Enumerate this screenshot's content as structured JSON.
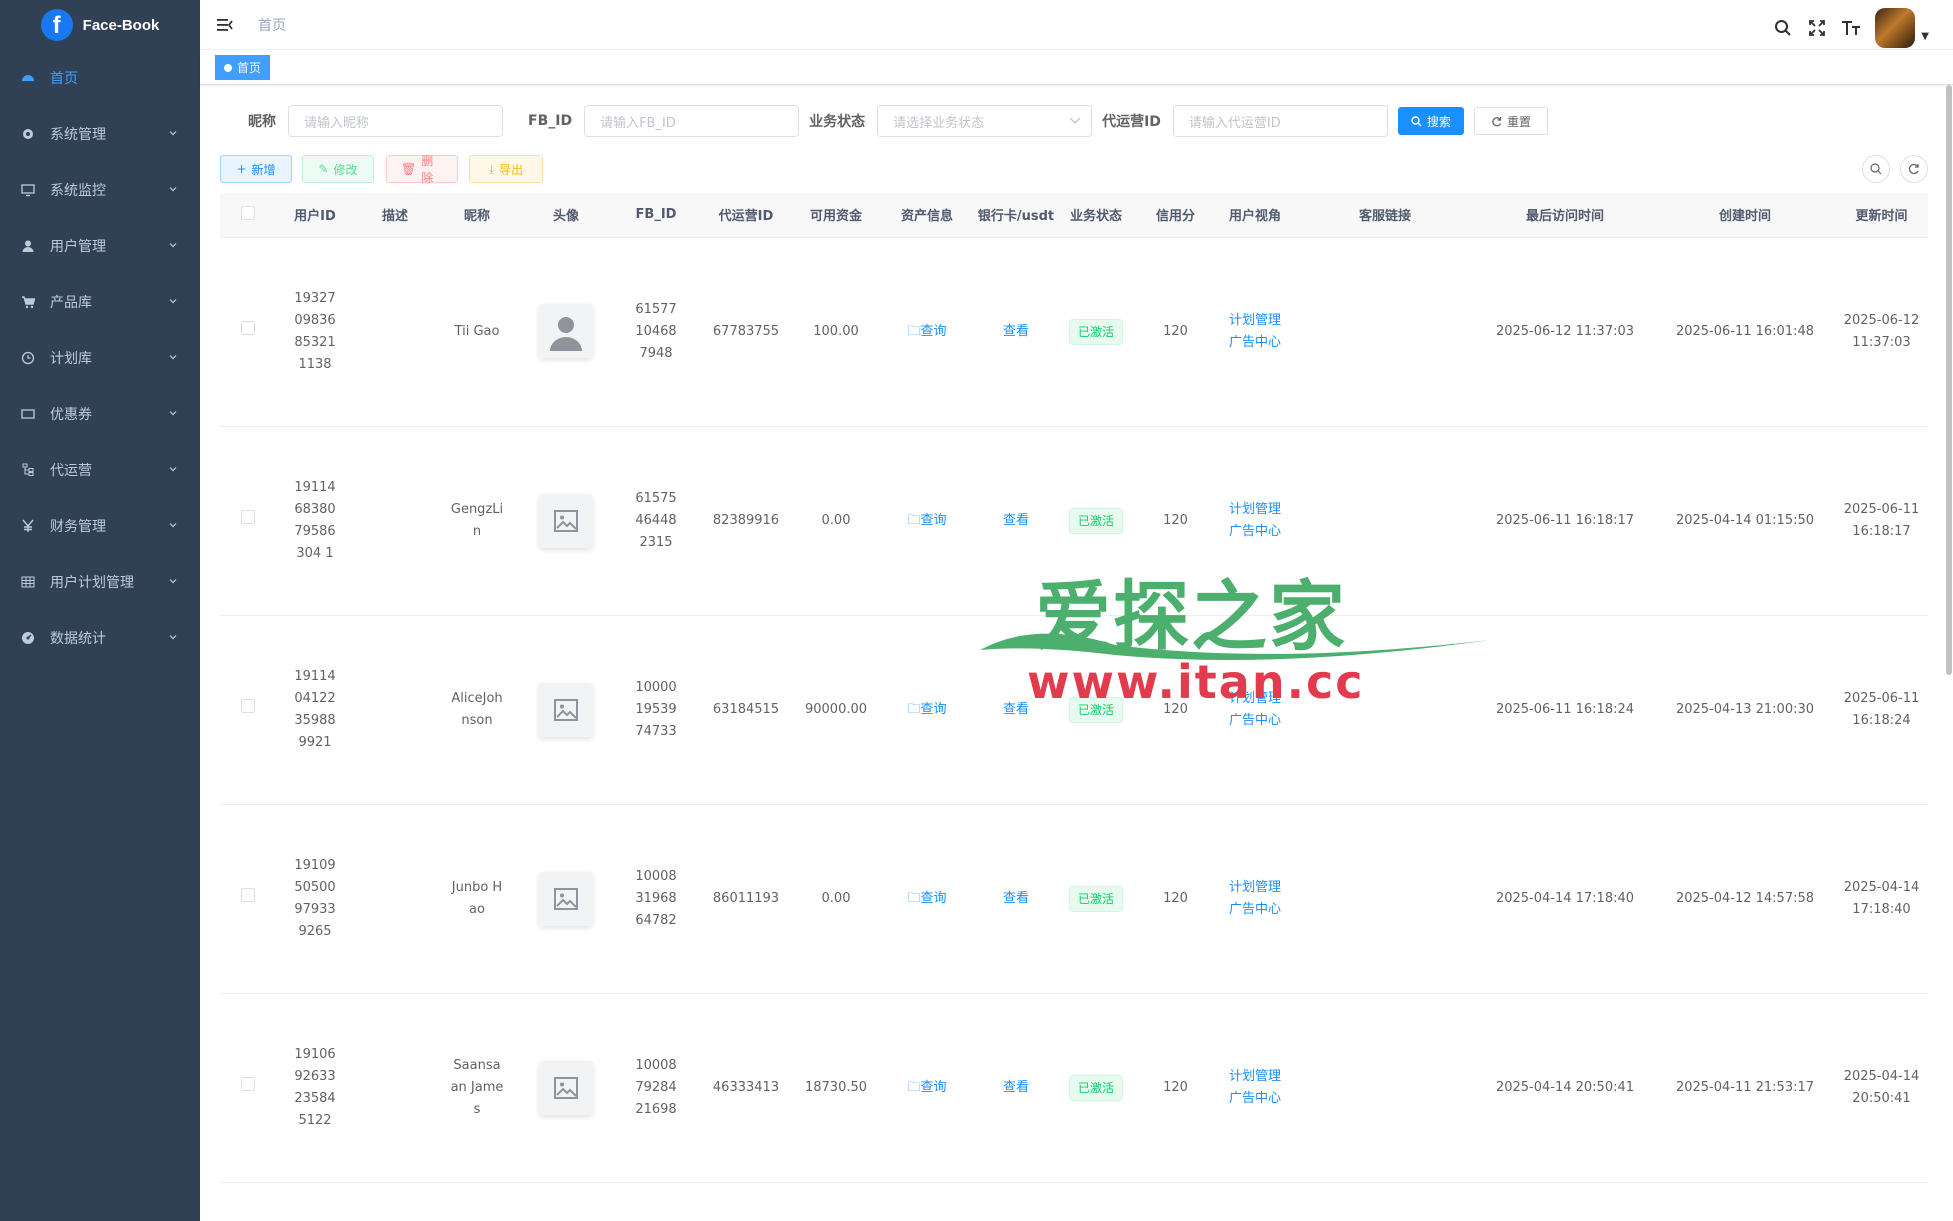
{
  "app": {
    "brand": "Face-Book",
    "logo_letter": "f"
  },
  "sidebar": {
    "items": [
      {
        "label": "首页",
        "icon": "dashboard-icon",
        "active": true,
        "expandable": false
      },
      {
        "label": "系统管理",
        "icon": "gear-icon",
        "expandable": true
      },
      {
        "label": "系统监控",
        "icon": "monitor-icon",
        "expandable": true
      },
      {
        "label": "用户管理",
        "icon": "user-icon",
        "expandable": true
      },
      {
        "label": "产品库",
        "icon": "cart-icon",
        "expandable": true
      },
      {
        "label": "计划库",
        "icon": "clock-icon",
        "expandable": true
      },
      {
        "label": "优惠券",
        "icon": "coupon-icon",
        "expandable": true
      },
      {
        "label": "代运营",
        "icon": "tree-icon",
        "expandable": true
      },
      {
        "label": "财务管理",
        "icon": "yen-icon",
        "expandable": true
      },
      {
        "label": "用户计划管理",
        "icon": "table-icon",
        "expandable": true
      },
      {
        "label": "数据统计",
        "icon": "chart-icon",
        "expandable": true
      }
    ]
  },
  "header": {
    "breadcrumb": "首页"
  },
  "tags": {
    "active": "首页"
  },
  "search": {
    "nickname_label": "昵称",
    "nickname_placeholder": "请输入昵称",
    "fbid_label": "FB_ID",
    "fbid_placeholder": "请输入FB_ID",
    "status_label": "业务状态",
    "status_placeholder": "请选择业务状态",
    "agent_label": "代运营ID",
    "agent_placeholder": "请输入代运营ID",
    "search_btn": "搜索",
    "reset_btn": "重置"
  },
  "toolbar": {
    "add": "新增",
    "edit": "修改",
    "delete": "删除",
    "export": "导出"
  },
  "table": {
    "headers": [
      "用户ID",
      "描述",
      "昵称",
      "头像",
      "FB_ID",
      "代运营ID",
      "可用资金",
      "资产信息",
      "银行卡/usdt",
      "业务状态",
      "信用分",
      "用户视角",
      "客服链接",
      "最后访问时间",
      "创建时间",
      "更新时间"
    ],
    "asset_link": "查询",
    "bank_link": "查看",
    "view_link_1": "计划管理",
    "view_link_2": "广告中心",
    "rows": [
      {
        "user_id": "1932709836853211138",
        "desc": "",
        "nickname": "Tii Gao",
        "avatar": "person",
        "fb_id": "61577104687948",
        "agent_id": "67783755",
        "balance": "100.00",
        "status": "已激活",
        "credit": "120",
        "last_visit": "2025-06-12 11:37:03",
        "created": "2025-06-11 16:01:48",
        "updated": "2025-06-12 11:37:03"
      },
      {
        "user_id": "191146838079586304 1",
        "desc": "",
        "nickname": "GengzLin",
        "avatar": "image",
        "fb_id": "61575464482315",
        "agent_id": "82389916",
        "balance": "0.00",
        "status": "已激活",
        "credit": "120",
        "last_visit": "2025-06-11 16:18:17",
        "created": "2025-04-14 01:15:50",
        "updated": "2025-06-11 16:18:17"
      },
      {
        "user_id": "1911404122359889921",
        "desc": "",
        "nickname": "AliceJohnson",
        "avatar": "image",
        "fb_id": "100001953974733",
        "agent_id": "63184515",
        "balance": "90000.00",
        "status": "已激活",
        "credit": "120",
        "last_visit": "2025-06-11 16:18:24",
        "created": "2025-04-13 21:00:30",
        "updated": "2025-06-11 16:18:24"
      },
      {
        "user_id": "1910950500979339265",
        "desc": "",
        "nickname": "Junbo Hao",
        "avatar": "image",
        "fb_id": "100083196864782",
        "agent_id": "86011193",
        "balance": "0.00",
        "status": "已激活",
        "credit": "120",
        "last_visit": "2025-04-14 17:18:40",
        "created": "2025-04-12 14:57:58",
        "updated": "2025-04-14 17:18:40"
      },
      {
        "user_id": "1910692633235845122",
        "desc": "",
        "nickname": "Saansaan James",
        "avatar": "image",
        "fb_id": "100087928421698",
        "agent_id": "46333413",
        "balance": "18730.50",
        "status": "已激活",
        "credit": "120",
        "last_visit": "2025-04-14 20:50:41",
        "created": "2025-04-11 21:53:17",
        "updated": "2025-04-14 20:50:41"
      }
    ]
  },
  "watermark": {
    "top": "爱探之家",
    "bottom": "www.itan.cc"
  },
  "colors": {
    "sidebar_bg": "#304156",
    "primary": "#1890ff",
    "success": "#13ce66",
    "danger": "#ff4949",
    "warning": "#ffba00"
  }
}
